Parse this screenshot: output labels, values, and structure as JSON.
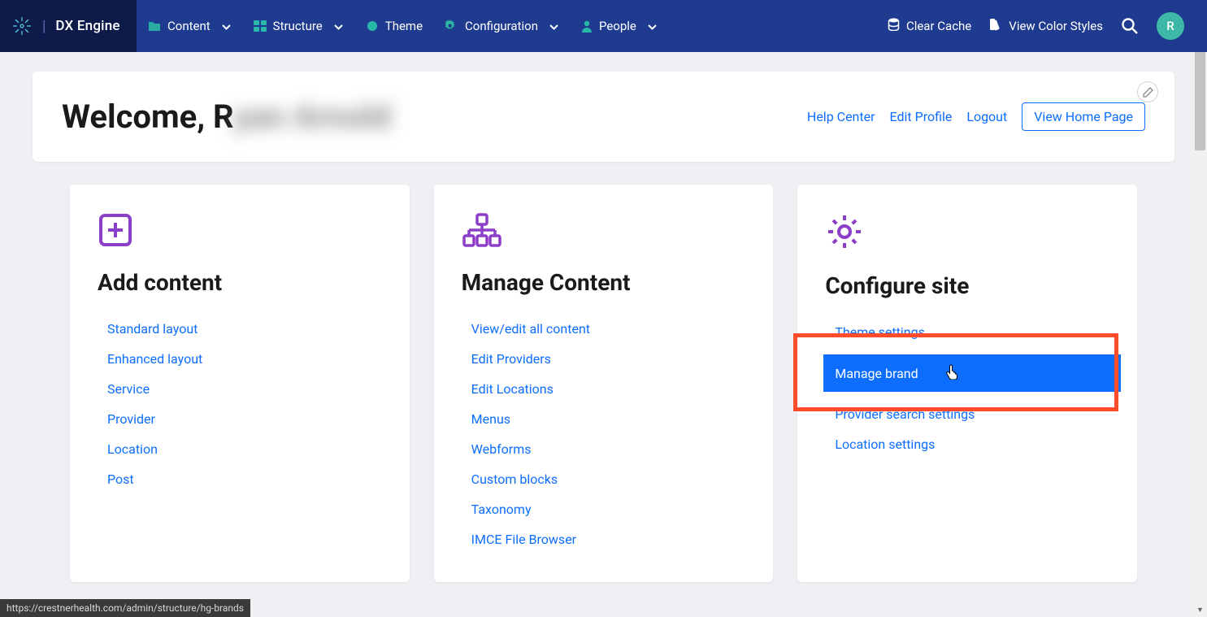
{
  "brand": {
    "name": "DX Engine"
  },
  "nav": [
    {
      "label": "Content",
      "icon": "folder",
      "chevron": true
    },
    {
      "label": "Structure",
      "icon": "blocks",
      "chevron": true
    },
    {
      "label": "Theme",
      "icon": "palette",
      "chevron": false
    },
    {
      "label": "Configuration",
      "icon": "gear",
      "chevron": true
    },
    {
      "label": "People",
      "icon": "person",
      "chevron": true
    }
  ],
  "topbar_actions": {
    "clear_cache": "Clear Cache",
    "view_color_styles": "View Color Styles"
  },
  "avatar_initial": "R",
  "hero": {
    "welcome_prefix": "Welcome, R",
    "welcome_blur": "yan Arnold",
    "links": {
      "help": "Help Center",
      "edit_profile": "Edit Profile",
      "logout": "Logout",
      "view_home": "View Home Page"
    }
  },
  "cards": {
    "add": {
      "title": "Add content",
      "items": [
        "Standard layout",
        "Enhanced layout",
        "Service",
        "Provider",
        "Location",
        "Post"
      ]
    },
    "manage": {
      "title": "Manage Content",
      "items": [
        "View/edit all content",
        "Edit Providers",
        "Edit Locations",
        "Menus",
        "Webforms",
        "Custom blocks",
        "Taxonomy",
        "IMCE File Browser"
      ]
    },
    "configure": {
      "title": "Configure site",
      "items": [
        "Theme settings",
        "Manage brand",
        "Provider search settings",
        "Location settings"
      ]
    }
  },
  "status_url": "https://crestnerhealth.com/admin/structure/hg-brands"
}
